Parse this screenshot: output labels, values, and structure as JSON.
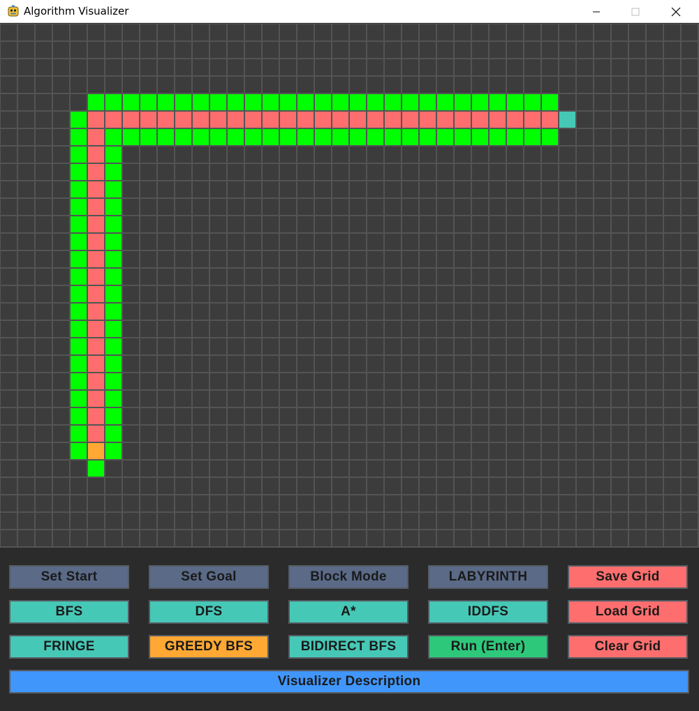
{
  "window": {
    "title": "Algorithm Visualizer",
    "icon": "python-icon",
    "controls": [
      "minimize-icon",
      "maximize-icon",
      "close-icon"
    ]
  },
  "grid": {
    "cols": 40,
    "rows": 30,
    "colors": {
      "background": "#3c3c3c",
      "gridline": "#545454",
      "visited": "#00ff00",
      "path": "#ff6e6e",
      "start": "#ffa833",
      "goal": "#46c8b6"
    },
    "cells": {
      "start": [
        [
          5,
          24
        ]
      ],
      "goal": [
        [
          32,
          5
        ]
      ],
      "path": [
        [
          5,
          5
        ],
        [
          6,
          5
        ],
        [
          7,
          5
        ],
        [
          8,
          5
        ],
        [
          9,
          5
        ],
        [
          10,
          5
        ],
        [
          11,
          5
        ],
        [
          12,
          5
        ],
        [
          13,
          5
        ],
        [
          14,
          5
        ],
        [
          15,
          5
        ],
        [
          16,
          5
        ],
        [
          17,
          5
        ],
        [
          18,
          5
        ],
        [
          19,
          5
        ],
        [
          20,
          5
        ],
        [
          21,
          5
        ],
        [
          22,
          5
        ],
        [
          23,
          5
        ],
        [
          24,
          5
        ],
        [
          25,
          5
        ],
        [
          26,
          5
        ],
        [
          27,
          5
        ],
        [
          28,
          5
        ],
        [
          29,
          5
        ],
        [
          30,
          5
        ],
        [
          31,
          5
        ],
        [
          5,
          6
        ],
        [
          5,
          7
        ],
        [
          5,
          8
        ],
        [
          5,
          9
        ],
        [
          5,
          10
        ],
        [
          5,
          11
        ],
        [
          5,
          12
        ],
        [
          5,
          13
        ],
        [
          5,
          14
        ],
        [
          5,
          15
        ],
        [
          5,
          16
        ],
        [
          5,
          17
        ],
        [
          5,
          18
        ],
        [
          5,
          19
        ],
        [
          5,
          20
        ],
        [
          5,
          21
        ],
        [
          5,
          22
        ],
        [
          5,
          23
        ]
      ],
      "visited": [
        [
          5,
          4
        ],
        [
          6,
          4
        ],
        [
          7,
          4
        ],
        [
          8,
          4
        ],
        [
          9,
          4
        ],
        [
          10,
          4
        ],
        [
          11,
          4
        ],
        [
          12,
          4
        ],
        [
          13,
          4
        ],
        [
          14,
          4
        ],
        [
          15,
          4
        ],
        [
          16,
          4
        ],
        [
          17,
          4
        ],
        [
          18,
          4
        ],
        [
          19,
          4
        ],
        [
          20,
          4
        ],
        [
          21,
          4
        ],
        [
          22,
          4
        ],
        [
          23,
          4
        ],
        [
          24,
          4
        ],
        [
          25,
          4
        ],
        [
          26,
          4
        ],
        [
          27,
          4
        ],
        [
          28,
          4
        ],
        [
          29,
          4
        ],
        [
          30,
          4
        ],
        [
          31,
          4
        ],
        [
          4,
          5
        ],
        [
          4,
          6
        ],
        [
          6,
          6
        ],
        [
          7,
          6
        ],
        [
          8,
          6
        ],
        [
          9,
          6
        ],
        [
          10,
          6
        ],
        [
          11,
          6
        ],
        [
          12,
          6
        ],
        [
          13,
          6
        ],
        [
          14,
          6
        ],
        [
          15,
          6
        ],
        [
          16,
          6
        ],
        [
          17,
          6
        ],
        [
          18,
          6
        ],
        [
          19,
          6
        ],
        [
          20,
          6
        ],
        [
          21,
          6
        ],
        [
          22,
          6
        ],
        [
          23,
          6
        ],
        [
          24,
          6
        ],
        [
          25,
          6
        ],
        [
          26,
          6
        ],
        [
          27,
          6
        ],
        [
          28,
          6
        ],
        [
          29,
          6
        ],
        [
          30,
          6
        ],
        [
          31,
          6
        ],
        [
          4,
          7
        ],
        [
          6,
          7
        ],
        [
          4,
          8
        ],
        [
          6,
          8
        ],
        [
          4,
          9
        ],
        [
          6,
          9
        ],
        [
          4,
          10
        ],
        [
          6,
          10
        ],
        [
          4,
          11
        ],
        [
          6,
          11
        ],
        [
          4,
          12
        ],
        [
          6,
          12
        ],
        [
          4,
          13
        ],
        [
          6,
          13
        ],
        [
          4,
          14
        ],
        [
          6,
          14
        ],
        [
          4,
          15
        ],
        [
          6,
          15
        ],
        [
          4,
          16
        ],
        [
          6,
          16
        ],
        [
          4,
          17
        ],
        [
          6,
          17
        ],
        [
          4,
          18
        ],
        [
          6,
          18
        ],
        [
          4,
          19
        ],
        [
          6,
          19
        ],
        [
          4,
          20
        ],
        [
          6,
          20
        ],
        [
          4,
          21
        ],
        [
          6,
          21
        ],
        [
          4,
          22
        ],
        [
          6,
          22
        ],
        [
          4,
          23
        ],
        [
          6,
          23
        ],
        [
          4,
          24
        ],
        [
          6,
          24
        ],
        [
          5,
          25
        ]
      ]
    }
  },
  "buttons": [
    {
      "id": "set-start-button",
      "label": "Set Start",
      "color": "#5a6a87"
    },
    {
      "id": "set-goal-button",
      "label": "Set Goal",
      "color": "#5a6a87"
    },
    {
      "id": "block-mode-button",
      "label": "Block Mode",
      "color": "#5a6a87"
    },
    {
      "id": "labyrinth-button",
      "label": "LABYRINTH",
      "color": "#5a6a87"
    },
    {
      "id": "save-grid-button",
      "label": "Save Grid",
      "color": "#ff6e6e"
    },
    {
      "id": "bfs-button",
      "label": "BFS",
      "color": "#46c8b6"
    },
    {
      "id": "dfs-button",
      "label": "DFS",
      "color": "#46c8b6"
    },
    {
      "id": "astar-button",
      "label": "A*",
      "color": "#46c8b6"
    },
    {
      "id": "iddfs-button",
      "label": "IDDFS",
      "color": "#46c8b6"
    },
    {
      "id": "load-grid-button",
      "label": "Load Grid",
      "color": "#ff6e6e"
    },
    {
      "id": "fringe-button",
      "label": "FRINGE",
      "color": "#46c8b6"
    },
    {
      "id": "greedy-bfs-button",
      "label": "GREEDY BFS",
      "color": "#ffa833"
    },
    {
      "id": "bidirect-bfs-button",
      "label": "BIDIRECT BFS",
      "color": "#46c8b6"
    },
    {
      "id": "run-button",
      "label": "Run (Enter)",
      "color": "#2ec87a"
    },
    {
      "id": "clear-grid-button",
      "label": "Clear Grid",
      "color": "#ff6e6e"
    }
  ],
  "description_button": {
    "label": "Visualizer Description",
    "color": "#4096fa"
  }
}
